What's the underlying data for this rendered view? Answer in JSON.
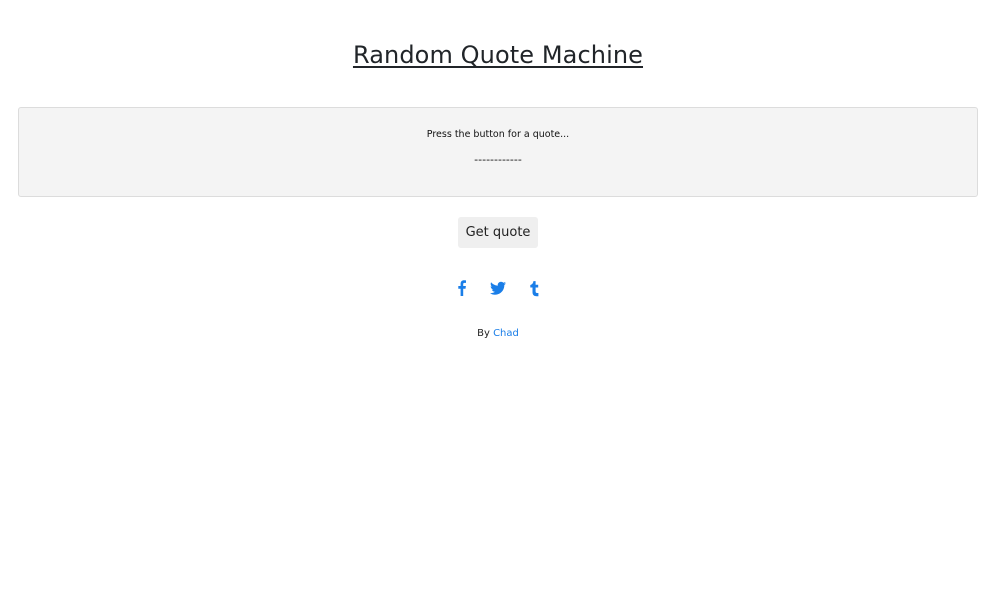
{
  "header": {
    "title": "Random Quote Machine"
  },
  "quote": {
    "text": "Press the button for a quote...",
    "author": "------------"
  },
  "actions": {
    "get_quote_label": "Get quote"
  },
  "social": {
    "icons": [
      "facebook-icon",
      "twitter-icon",
      "tumblr-icon"
    ],
    "color": "#1a7ee8"
  },
  "footer": {
    "by_label": "By",
    "author_link": "Chad"
  },
  "colors": {
    "accent": "#1a7ee8",
    "quote_background": "#f4f4f4",
    "button_background": "#efefef"
  }
}
